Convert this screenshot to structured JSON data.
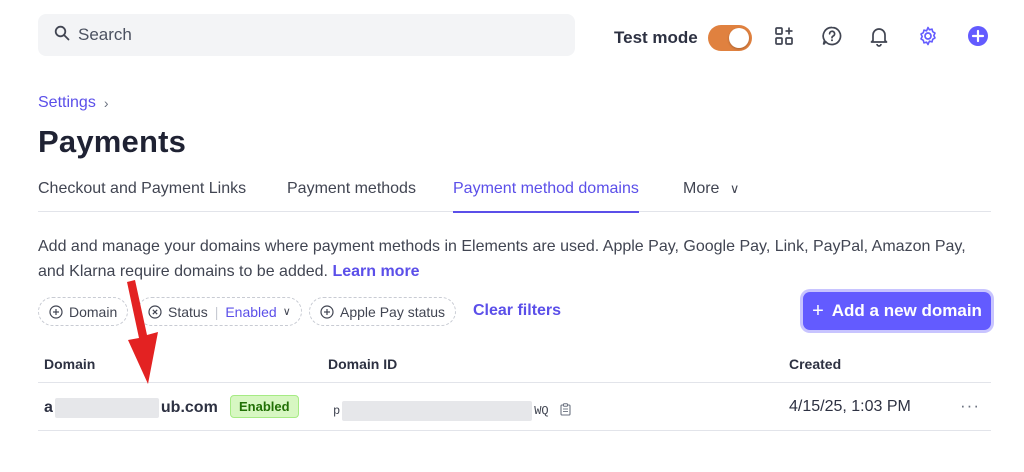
{
  "topbar": {
    "search_placeholder": "Search",
    "test_mode_label": "Test mode",
    "icons": [
      "apps-icon",
      "help-icon",
      "bell-icon",
      "gear-icon",
      "plus-circle-icon"
    ],
    "accent": "#635bff",
    "toggle_color": "#e0813f"
  },
  "breadcrumb": {
    "settings": "Settings"
  },
  "page": {
    "title": "Payments"
  },
  "tabs": [
    {
      "label": "Checkout and Payment Links"
    },
    {
      "label": "Payment methods"
    },
    {
      "label": "Payment method domains"
    },
    {
      "label": "More"
    }
  ],
  "description": {
    "text": "Add and manage your domains where payment methods in Elements are used. Apple Pay, Google Pay, Link, PayPal, Amazon Pay, and Klarna require domains to be added.",
    "link": "Learn more"
  },
  "filters": {
    "domain": "Domain",
    "status_label": "Status",
    "status_value": "Enabled",
    "apple_pay": "Apple Pay status",
    "clear": "Clear filters"
  },
  "actions": {
    "add_domain": "Add a new domain"
  },
  "table": {
    "headers": {
      "domain": "Domain",
      "domain_id": "Domain ID",
      "created": "Created"
    },
    "rows": [
      {
        "domain_prefix": "a",
        "domain_suffix": "ub.com",
        "status": "Enabled",
        "id_prefix": "p",
        "id_suffix": "WQ",
        "created": "4/15/25, 1:03 PM",
        "menu": "···"
      }
    ]
  }
}
